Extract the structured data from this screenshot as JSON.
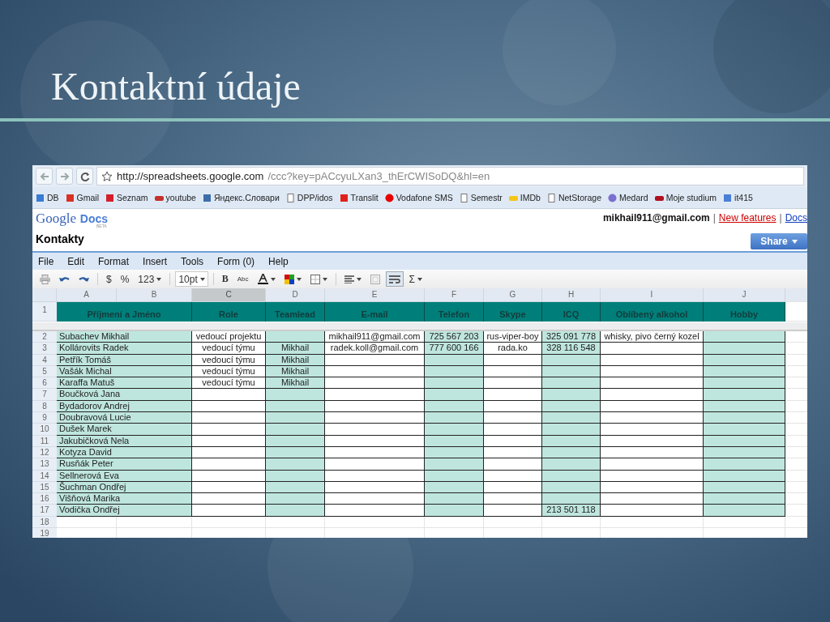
{
  "slide_title": "Kontaktní údaje",
  "browser": {
    "url_host": "http://spreadsheets.google.com",
    "url_path": "/ccc?key=pACcyuLXan3_thErCWISoDQ&hl=en",
    "bookmarks": [
      {
        "label": "DB",
        "kind": "db"
      },
      {
        "label": "Gmail",
        "kind": "gmail"
      },
      {
        "label": "Seznam",
        "kind": "seznam"
      },
      {
        "label": "youtube",
        "kind": "youtube"
      },
      {
        "label": "Яндекс.Словари",
        "kind": "dict"
      },
      {
        "label": "DPP/idos",
        "kind": "page"
      },
      {
        "label": "Translit",
        "kind": "translit"
      },
      {
        "label": "Vodafone SMS",
        "kind": "vodafone"
      },
      {
        "label": "Semestr",
        "kind": "page"
      },
      {
        "label": "IMDb",
        "kind": "imdb"
      },
      {
        "label": "NetStorage",
        "kind": "page"
      },
      {
        "label": "Medard",
        "kind": "medard"
      },
      {
        "label": "Moje studium",
        "kind": "studium"
      },
      {
        "label": "it415",
        "kind": "google"
      }
    ]
  },
  "docs": {
    "logo_google": "Google",
    "logo_docs": "Docs",
    "logo_beta": "BETA",
    "account": "mikhail911@gmail.com",
    "separator": "|",
    "links": [
      "New features",
      "Docs"
    ],
    "doc_title": "Kontakty",
    "share": "Share"
  },
  "menu": [
    "File",
    "Edit",
    "Format",
    "Insert",
    "Tools",
    "Form (0)",
    "Help"
  ],
  "toolbar": [
    [
      {
        "kind": "print",
        "pressed": false,
        "dropdown": false
      },
      {
        "kind": "undo",
        "pressed": false,
        "dropdown": false
      },
      {
        "kind": "redo",
        "pressed": false,
        "dropdown": false
      }
    ],
    [
      {
        "kind": "text",
        "label": "$",
        "pressed": false,
        "dropdown": false
      },
      {
        "kind": "text",
        "label": "%",
        "pressed": false,
        "dropdown": false
      },
      {
        "kind": "text",
        "label": "123",
        "pressed": false,
        "dropdown": true
      }
    ],
    [
      {
        "kind": "box",
        "label": "10pt",
        "pressed": false,
        "dropdown": true
      }
    ],
    [
      {
        "kind": "bold",
        "label": "B",
        "pressed": false,
        "dropdown": false
      },
      {
        "kind": "strike",
        "label": "Abc",
        "pressed": false,
        "dropdown": false
      },
      {
        "kind": "textcolor",
        "pressed": false,
        "dropdown": true
      },
      {
        "kind": "fillcolor",
        "pressed": false,
        "dropdown": true
      },
      {
        "kind": "borders",
        "pressed": false,
        "dropdown": true
      }
    ],
    [
      {
        "kind": "align",
        "pressed": false,
        "dropdown": true
      },
      {
        "kind": "merge",
        "pressed": false,
        "dropdown": false
      },
      {
        "kind": "wrap",
        "pressed": true,
        "dropdown": false
      },
      {
        "kind": "text",
        "label": "Σ",
        "pressed": false,
        "dropdown": true
      }
    ]
  ],
  "column_letters": [
    {
      "label": "A",
      "selected": false
    },
    {
      "label": "B",
      "selected": false
    },
    {
      "label": "C",
      "selected": true
    },
    {
      "label": "D",
      "selected": false
    },
    {
      "label": "E",
      "selected": false
    },
    {
      "label": "F",
      "selected": false
    },
    {
      "label": "G",
      "selected": false
    },
    {
      "label": "H",
      "selected": false
    },
    {
      "label": "I",
      "selected": false
    },
    {
      "label": "J",
      "selected": false
    }
  ],
  "header_row": "1",
  "fields": [
    {
      "heading": "Příjmení a Jméno",
      "shaded": true
    },
    {
      "heading": "Role",
      "shaded": false
    },
    {
      "heading": "Teamlead",
      "shaded": true
    },
    {
      "heading": "E-mail",
      "shaded": false
    },
    {
      "heading": "Telefon",
      "shaded": true
    },
    {
      "heading": "Skype",
      "shaded": false
    },
    {
      "heading": "ICQ",
      "shaded": true
    },
    {
      "heading": "Oblíbený alkohol",
      "shaded": false
    },
    {
      "heading": "Hobby",
      "shaded": true
    }
  ],
  "rows": [
    {
      "row": "2",
      "kind": "data",
      "name": "Subachev Mikhail",
      "role": "vedoucí projektu",
      "email": "mikhail911@gmail.com",
      "phone": "725 567 203",
      "skype": "rus-viper-boy",
      "icq": "325 091 778",
      "alcohol": "whisky, pivo černý kozel"
    },
    {
      "row": "3",
      "kind": "data",
      "name": "Kollárovits Radek",
      "role": "vedoucí týmu",
      "teamlead": "Mikhail",
      "email": "radek.koll@gmail.com",
      "phone": "777 600 166",
      "skype": "rada.ko",
      "icq": "328 116 548"
    },
    {
      "row": "4",
      "kind": "data",
      "name": "Petřík Tomáš",
      "role": "vedoucí týmu",
      "teamlead": "Mikhail"
    },
    {
      "row": "5",
      "kind": "data",
      "name": "Vašák Michal",
      "role": "vedoucí týmu",
      "teamlead": "Mikhail"
    },
    {
      "row": "6",
      "kind": "data",
      "name": "Karaffa Matuš",
      "role": "vedoucí týmu",
      "teamlead": "Mikhail"
    },
    {
      "row": "7",
      "kind": "data",
      "name": "Boučková Jana"
    },
    {
      "row": "8",
      "kind": "data",
      "name": "Bydadorov Andrej"
    },
    {
      "row": "9",
      "kind": "data",
      "name": "Doubravová Lucie"
    },
    {
      "row": "10",
      "kind": "data",
      "name": "Dušek Marek"
    },
    {
      "row": "11",
      "kind": "data",
      "name": "Jakubičková Nela"
    },
    {
      "row": "12",
      "kind": "data",
      "name": "Kotyza David"
    },
    {
      "row": "13",
      "kind": "data",
      "name": "Rusňák Peter"
    },
    {
      "row": "14",
      "kind": "data",
      "name": "Sellnerová Eva"
    },
    {
      "row": "15",
      "kind": "data",
      "name": "Šuchman Ondřej"
    },
    {
      "row": "16",
      "kind": "data",
      "name": "Višňová Marika"
    },
    {
      "row": "17",
      "kind": "data",
      "name": "Vodička Ondřej",
      "icq": "213 501 118"
    },
    {
      "row": "18",
      "kind": "blank"
    },
    {
      "row": "19",
      "kind": "blank"
    }
  ]
}
